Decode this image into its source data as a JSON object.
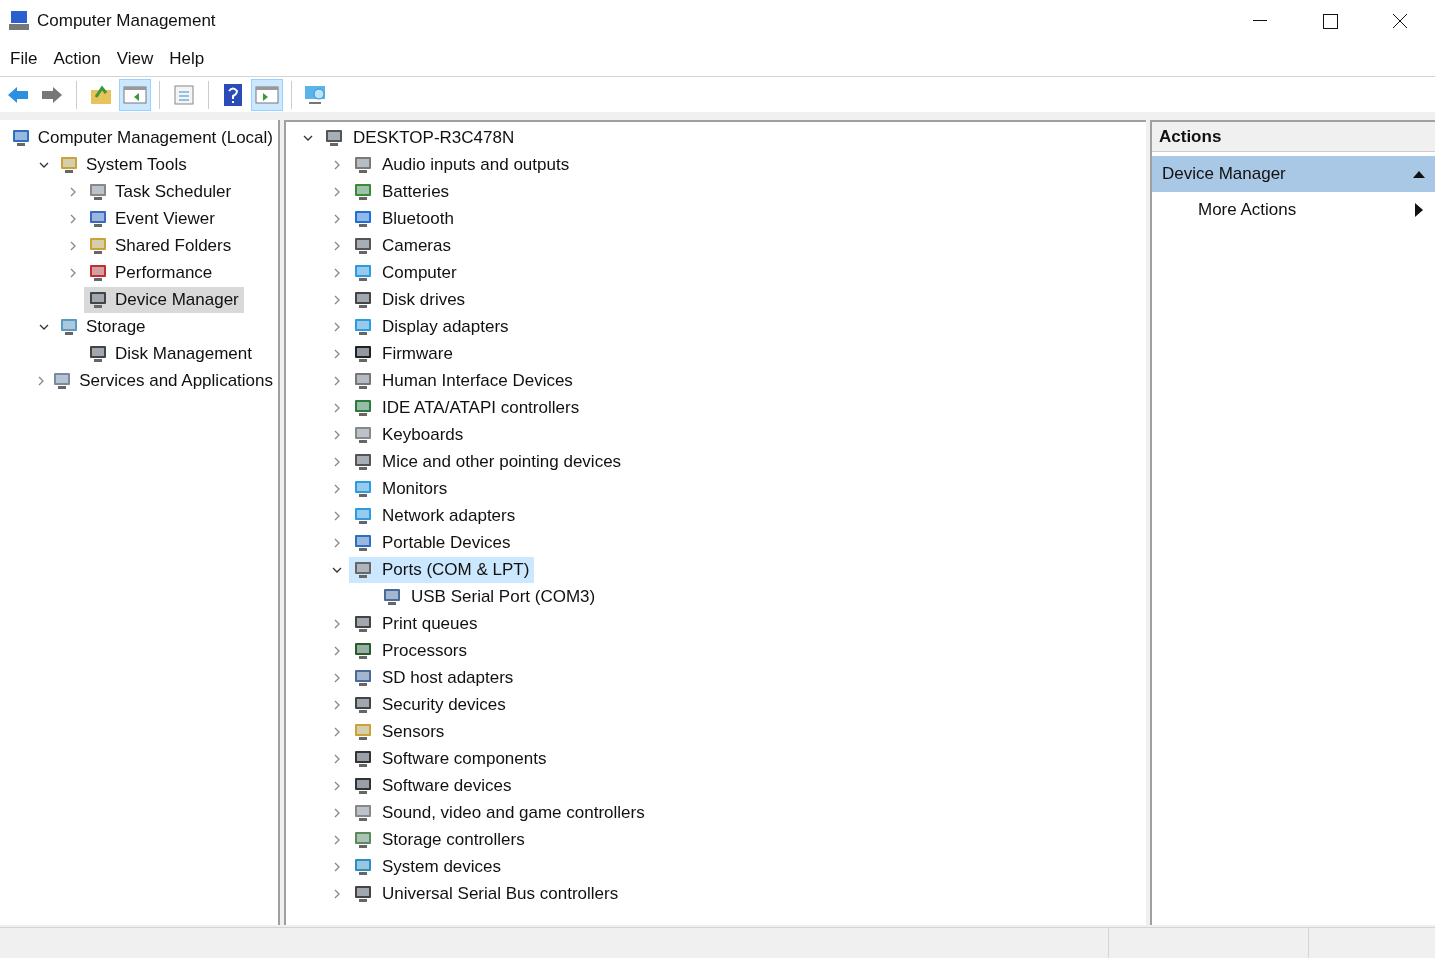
{
  "window": {
    "title": "Computer Management"
  },
  "menu": [
    "File",
    "Action",
    "View",
    "Help"
  ],
  "toolbar": [
    {
      "kind": "back",
      "pressed": false
    },
    {
      "kind": "forward",
      "pressed": false
    },
    {
      "kind": "sep"
    },
    {
      "kind": "up",
      "pressed": false
    },
    {
      "kind": "tree",
      "pressed": true
    },
    {
      "kind": "sep"
    },
    {
      "kind": "props",
      "pressed": false
    },
    {
      "kind": "sep"
    },
    {
      "kind": "help",
      "pressed": false
    },
    {
      "kind": "pane",
      "pressed": true
    },
    {
      "kind": "sep"
    },
    {
      "kind": "monitor",
      "pressed": false
    }
  ],
  "console_tree": [
    {
      "label": "Computer Management (Local)",
      "selected": false,
      "children": [
        {
          "label": "System Tools",
          "expanded": true,
          "selected": false,
          "children": [
            {
              "label": "Task Scheduler",
              "expanded": false,
              "selected": false
            },
            {
              "label": "Event Viewer",
              "expanded": false,
              "selected": false
            },
            {
              "label": "Shared Folders",
              "expanded": false,
              "selected": false
            },
            {
              "label": "Performance",
              "expanded": false,
              "selected": false
            },
            {
              "label": "Device Manager",
              "selected": true
            }
          ]
        },
        {
          "label": "Storage",
          "expanded": true,
          "selected": false,
          "children": [
            {
              "label": "Disk Management",
              "selected": false
            }
          ]
        },
        {
          "label": "Services and Applications",
          "expanded": false,
          "selected": false
        }
      ]
    }
  ],
  "device_tree": {
    "label": "DESKTOP-R3C478N",
    "expanded": true,
    "children": [
      {
        "label": "Audio inputs and outputs",
        "expanded": false,
        "selected": false
      },
      {
        "label": "Batteries",
        "expanded": false,
        "selected": false
      },
      {
        "label": "Bluetooth",
        "expanded": false,
        "selected": false
      },
      {
        "label": "Cameras",
        "expanded": false,
        "selected": false
      },
      {
        "label": "Computer",
        "expanded": false,
        "selected": false
      },
      {
        "label": "Disk drives",
        "expanded": false,
        "selected": false
      },
      {
        "label": "Display adapters",
        "expanded": false,
        "selected": false
      },
      {
        "label": "Firmware",
        "expanded": false,
        "selected": false
      },
      {
        "label": "Human Interface Devices",
        "expanded": false,
        "selected": false
      },
      {
        "label": "IDE ATA/ATAPI controllers",
        "expanded": false,
        "selected": false
      },
      {
        "label": "Keyboards",
        "expanded": false,
        "selected": false
      },
      {
        "label": "Mice and other pointing devices",
        "expanded": false,
        "selected": false
      },
      {
        "label": "Monitors",
        "expanded": false,
        "selected": false
      },
      {
        "label": "Network adapters",
        "expanded": false,
        "selected": false
      },
      {
        "label": "Portable Devices",
        "expanded": false,
        "selected": false
      },
      {
        "label": "Ports (COM & LPT)",
        "expanded": true,
        "selected": true,
        "children": [
          {
            "label": "USB Serial Port (COM3)",
            "selected": false
          }
        ]
      },
      {
        "label": "Print queues",
        "expanded": false,
        "selected": false
      },
      {
        "label": "Processors",
        "expanded": false,
        "selected": false
      },
      {
        "label": "SD host adapters",
        "expanded": false,
        "selected": false
      },
      {
        "label": "Security devices",
        "expanded": false,
        "selected": false
      },
      {
        "label": "Sensors",
        "expanded": false,
        "selected": false
      },
      {
        "label": "Software components",
        "expanded": false,
        "selected": false
      },
      {
        "label": "Software devices",
        "expanded": false,
        "selected": false
      },
      {
        "label": "Sound, video and game controllers",
        "expanded": false,
        "selected": false
      },
      {
        "label": "Storage controllers",
        "expanded": false,
        "selected": false
      },
      {
        "label": "System devices",
        "expanded": false,
        "selected": false
      },
      {
        "label": "Universal Serial Bus controllers",
        "expanded": false,
        "selected": false
      }
    ]
  },
  "actions": {
    "title": "Actions",
    "section": {
      "label": "Device Manager",
      "expanded": true
    },
    "items": [
      {
        "label": "More Actions"
      }
    ]
  }
}
